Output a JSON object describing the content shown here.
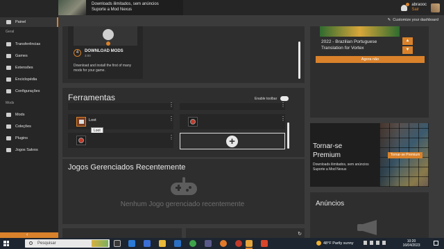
{
  "header": {
    "banner_line1": "Downloads ilimitados, sem anúncios",
    "banner_line2": "Suporte a Mod Nexus",
    "username": "abraooc",
    "user_tier": "Sair",
    "customize_label": "Customize your dashboard"
  },
  "sidebar": {
    "top_item": "Painel",
    "section_geral": "Geral",
    "geral_items": [
      "Transferências",
      "Games",
      "Extensões",
      "Enciclopédia",
      "Configurações"
    ],
    "section_mods": "Mods",
    "mods_items": [
      "Mods",
      "Coleções",
      "Plugins",
      "Jogos Salvos"
    ],
    "collapse_glyph": "‹"
  },
  "download_card": {
    "step_number": "4",
    "title": "DOWNLOAD MODS",
    "duration": "3:00",
    "description": "Download and install the first of many mods for your game."
  },
  "tools": {
    "title": "Ferramentas",
    "toggle_label": "Enable toolbar",
    "loot_label": "Loot",
    "tooltip": "Loot",
    "add_glyph": "+",
    "menu_glyph": "⋮"
  },
  "games": {
    "title": "Jogos Gerenciados Recentemente",
    "empty_message": "Nenhum Jogo gerenciado recentemente"
  },
  "translation": {
    "title_line1": "2022 - Brazilian Portuguese",
    "title_line2": "Translation for Vortex",
    "button": "Agora não"
  },
  "premium": {
    "title_line1": "Tornar-se",
    "title_line2": "Premium",
    "button": "Tornar-se Premium",
    "desc_line1": "Downloads ilimitados, sem anúncios",
    "desc_line2": "Suporte a Mod Nexus"
  },
  "ads": {
    "title": "Anúncios"
  },
  "taskbar": {
    "search_placeholder": "Pesquisar",
    "weather": "48°F  Partly sunny",
    "time": "10:20",
    "date": "16/04/2023"
  },
  "colors": {
    "accent": "#d9822b",
    "panel": "#2e2e2e",
    "background": "#3b3b3b",
    "sidebar": "#262626"
  }
}
